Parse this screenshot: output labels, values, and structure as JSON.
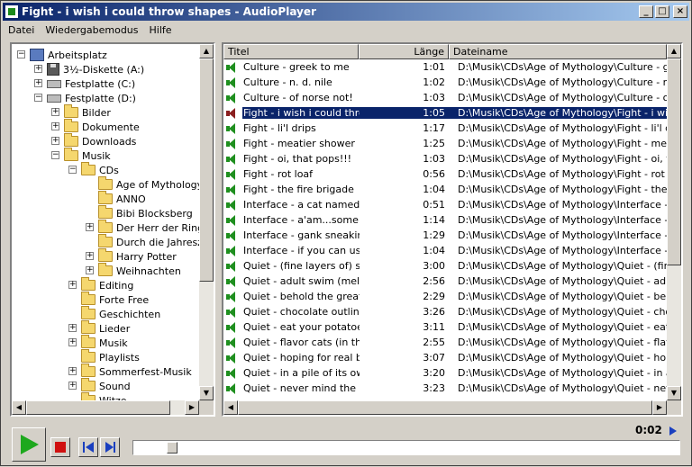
{
  "window": {
    "title": "Fight - i wish i could throw shapes - AudioPlayer",
    "minimize": "_",
    "maximize": "□",
    "close": "×"
  },
  "menu": [
    "Datei",
    "Wiedergabemodus",
    "Hilfe"
  ],
  "tree": [
    {
      "label": "Arbeitsplatz",
      "level": 0,
      "icon": "computer-icon",
      "expander": "−"
    },
    {
      "label": "3½-Diskette (A:)",
      "level": 1,
      "icon": "floppy-icon",
      "expander": "+"
    },
    {
      "label": "Festplatte (C:)",
      "level": 1,
      "icon": "drive-icon",
      "expander": "+"
    },
    {
      "label": "Festplatte (D:)",
      "level": 1,
      "icon": "drive-icon",
      "expander": "−"
    },
    {
      "label": "Bilder",
      "level": 2,
      "icon": "folder-icon",
      "expander": "+"
    },
    {
      "label": "Dokumente",
      "level": 2,
      "icon": "folder-icon",
      "expander": "+"
    },
    {
      "label": "Downloads",
      "level": 2,
      "icon": "folder-icon",
      "expander": "+"
    },
    {
      "label": "Musik",
      "level": 2,
      "icon": "folder-icon",
      "expander": "−"
    },
    {
      "label": "CDs",
      "level": 3,
      "icon": "folder-icon",
      "expander": "−"
    },
    {
      "label": "Age of Mythology",
      "level": 4,
      "icon": "folder-icon",
      "expander": ""
    },
    {
      "label": "ANNO",
      "level": 4,
      "icon": "folder-icon",
      "expander": ""
    },
    {
      "label": "Bibi Blocksberg",
      "level": 4,
      "icon": "folder-icon",
      "expander": ""
    },
    {
      "label": "Der Herr der Ringe",
      "level": 4,
      "icon": "folder-icon",
      "expander": "+"
    },
    {
      "label": "Durch die Jahreszeiten",
      "level": 4,
      "icon": "folder-icon",
      "expander": ""
    },
    {
      "label": "Harry Potter",
      "level": 4,
      "icon": "folder-icon",
      "expander": "+"
    },
    {
      "label": "Weihnachten",
      "level": 4,
      "icon": "folder-icon",
      "expander": "+"
    },
    {
      "label": "Editing",
      "level": 3,
      "icon": "folder-icon",
      "expander": "+"
    },
    {
      "label": "Forte Free",
      "level": 3,
      "icon": "folder-icon",
      "expander": ""
    },
    {
      "label": "Geschichten",
      "level": 3,
      "icon": "folder-icon",
      "expander": ""
    },
    {
      "label": "Lieder",
      "level": 3,
      "icon": "folder-icon",
      "expander": "+"
    },
    {
      "label": "Musik",
      "level": 3,
      "icon": "folder-icon",
      "expander": "+"
    },
    {
      "label": "Playlists",
      "level": 3,
      "icon": "folder-icon",
      "expander": ""
    },
    {
      "label": "Sommerfest-Musik",
      "level": 3,
      "icon": "folder-icon",
      "expander": "+"
    },
    {
      "label": "Sound",
      "level": 3,
      "icon": "folder-icon",
      "expander": "+"
    },
    {
      "label": "Witze",
      "level": 3,
      "icon": "folder-icon",
      "expander": ""
    }
  ],
  "list": {
    "columns": [
      "Titel",
      "Länge",
      "Dateiname"
    ],
    "rows": [
      {
        "title": "Culture - greek to me",
        "length": "1:01",
        "file": "D:\\Musik\\CDs\\Age of Mythology\\Culture - gree..."
      },
      {
        "title": "Culture - n. d. nile",
        "length": "1:02",
        "file": "D:\\Musik\\CDs\\Age of Mythology\\Culture - n. d. ..."
      },
      {
        "title": "Culture - of norse not!",
        "length": "1:03",
        "file": "D:\\Musik\\CDs\\Age of Mythology\\Culture - of no..."
      },
      {
        "title": "Fight - i wish i could thro...",
        "length": "1:05",
        "file": "D:\\Musik\\CDs\\Age of Mythology\\Fight - i wish i ...",
        "selected": true
      },
      {
        "title": "Fight - li'l drips",
        "length": "1:17",
        "file": "D:\\Musik\\CDs\\Age of Mythology\\Fight - li'l drips..."
      },
      {
        "title": "Fight - meatier shower",
        "length": "1:25",
        "file": "D:\\Musik\\CDs\\Age of Mythology\\Fight - meatier..."
      },
      {
        "title": "Fight - oi, that pops!!!",
        "length": "1:03",
        "file": "D:\\Musik\\CDs\\Age of Mythology\\Fight - oi, that ..."
      },
      {
        "title": "Fight - rot loaf",
        "length": "0:56",
        "file": "D:\\Musik\\CDs\\Age of Mythology\\Fight - rot loaf..."
      },
      {
        "title": "Fight - the fire brigade",
        "length": "1:04",
        "file": "D:\\Musik\\CDs\\Age of Mythology\\Fight - the fire ..."
      },
      {
        "title": "Interface - a cat named ...",
        "length": "0:51",
        "file": "D:\\Musik\\CDs\\Age of Mythology\\Interface - a c..."
      },
      {
        "title": "Interface - a'am...some ot...",
        "length": "1:14",
        "file": "D:\\Musik\\CDs\\Age of Mythology\\Interface - a'a..."
      },
      {
        "title": "Interface - gank sneakin'",
        "length": "1:29",
        "file": "D:\\Musik\\CDs\\Age of Mythology\\Interface - ga..."
      },
      {
        "title": "Interface - if you can use...",
        "length": "1:04",
        "file": "D:\\Musik\\CDs\\Age of Mythology\\Interface - if y..."
      },
      {
        "title": "Quiet - (fine layers of) sla...",
        "length": "3:00",
        "file": "D:\\Musik\\CDs\\Age of Mythology\\Quiet - (fine la..."
      },
      {
        "title": "Quiet - adult swim (mello...",
        "length": "2:56",
        "file": "D:\\Musik\\CDs\\Age of Mythology\\Quiet - adult s..."
      },
      {
        "title": "Quiet - behold the great s...",
        "length": "2:29",
        "file": "D:\\Musik\\CDs\\Age of Mythology\\Quiet - behold..."
      },
      {
        "title": "Quiet - chocolate outline ...",
        "length": "3:26",
        "file": "D:\\Musik\\CDs\\Age of Mythology\\Quiet - chocol..."
      },
      {
        "title": "Quiet - eat your potatoes ...",
        "length": "3:11",
        "file": "D:\\Musik\\CDs\\Age of Mythology\\Quiet - eat yo..."
      },
      {
        "title": "Quiet - flavor cats (in the ...",
        "length": "2:55",
        "file": "D:\\Musik\\CDs\\Age of Mythology\\Quiet - flavor ..."
      },
      {
        "title": "Quiet - hoping for real bet...",
        "length": "3:07",
        "file": "D:\\Musik\\CDs\\Age of Mythology\\Quiet - hoping..."
      },
      {
        "title": "Quiet - in a pile of its own...",
        "length": "3:20",
        "file": "D:\\Musik\\CDs\\Age of Mythology\\Quiet - in a pil..."
      },
      {
        "title": "Quiet - never mind the sl...",
        "length": "3:23",
        "file": "D:\\Musik\\CDs\\Age of Mythology\\Quiet - never ..."
      }
    ]
  },
  "player": {
    "time": "0:02",
    "progress_fraction": 0.03
  }
}
